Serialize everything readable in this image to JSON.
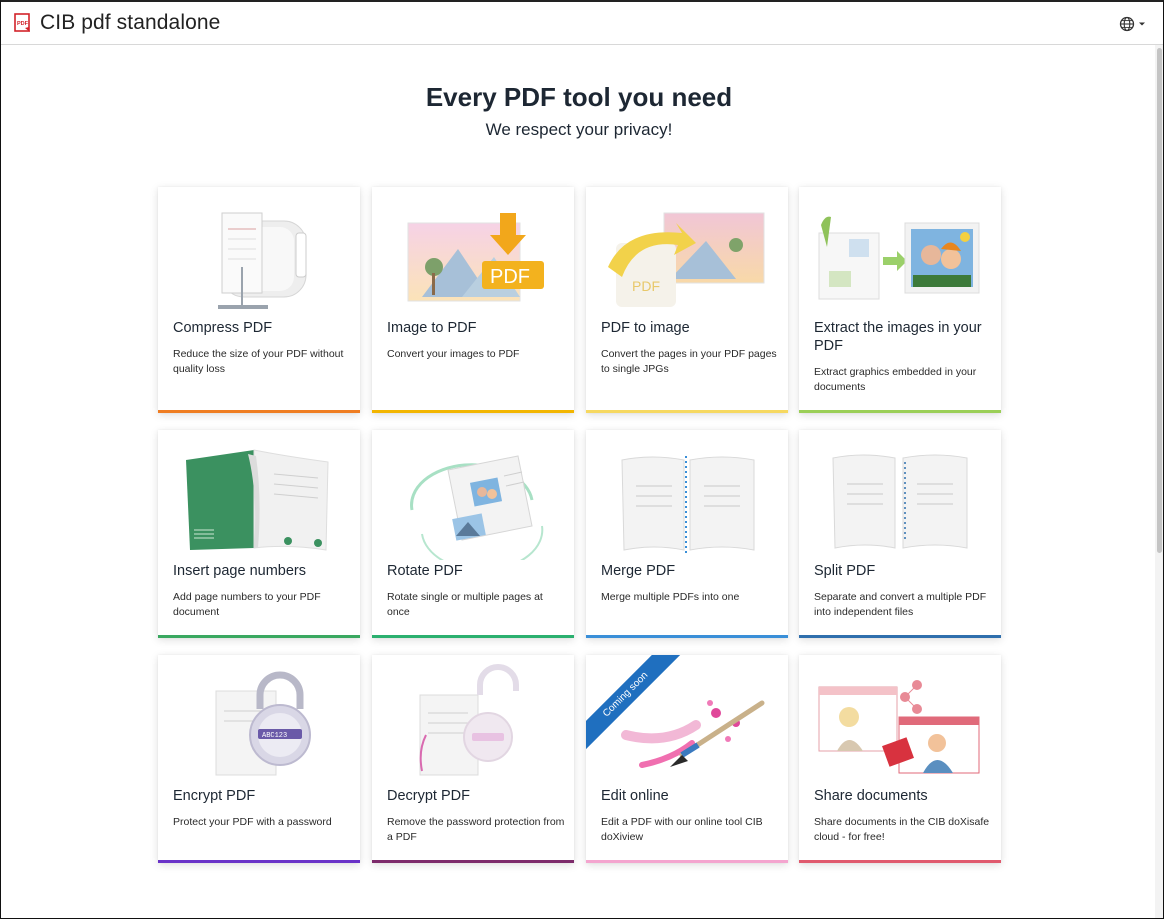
{
  "app": {
    "title": "CIB pdf standalone"
  },
  "header": {
    "language_icon": "globe-icon"
  },
  "hero": {
    "title": "Every PDF tool you need",
    "subtitle": "We respect your privacy!"
  },
  "colors": {
    "compress": "#ef7d22",
    "image_to_pdf": "#f2b500",
    "pdf_to_image": "#f6d860",
    "extract": "#9bcf57",
    "page_numbers": "#3aa860",
    "rotate": "#2bb06f",
    "merge": "#3a8fd8",
    "split": "#2f6fad",
    "encrypt": "#6a33c8",
    "decrypt": "#7d2b6b",
    "edit": "#f4a5cf",
    "share": "#e05a6e"
  },
  "tools": [
    {
      "title": "Compress PDF",
      "description": "Reduce the size of your PDF without quality loss"
    },
    {
      "title": "Image to PDF",
      "description": "Convert your images to PDF"
    },
    {
      "title": "PDF to image",
      "description": "Convert the pages in your PDF pages to single JPGs"
    },
    {
      "title": "Extract the images in your PDF",
      "description": "Extract graphics embedded in your documents"
    },
    {
      "title": "Insert page numbers",
      "description": "Add page numbers to your PDF document"
    },
    {
      "title": "Rotate PDF",
      "description": "Rotate single or multiple pages at once"
    },
    {
      "title": "Merge PDF",
      "description": "Merge multiple PDFs into one"
    },
    {
      "title": "Split PDF",
      "description": "Separate and convert a multiple PDF into independent files"
    },
    {
      "title": "Encrypt PDF",
      "description": "Protect your PDF with a password"
    },
    {
      "title": "Decrypt PDF",
      "description": "Remove the password protection from a PDF"
    },
    {
      "title": "Edit online",
      "description": "Edit a PDF with our online tool CIB doXiview",
      "badge": "Coming soon"
    },
    {
      "title": "Share documents",
      "description": "Share documents in the CIB doXisafe cloud - for free!"
    }
  ],
  "art_labels": {
    "pdf": "PDF",
    "lock_code": "ABC123"
  }
}
